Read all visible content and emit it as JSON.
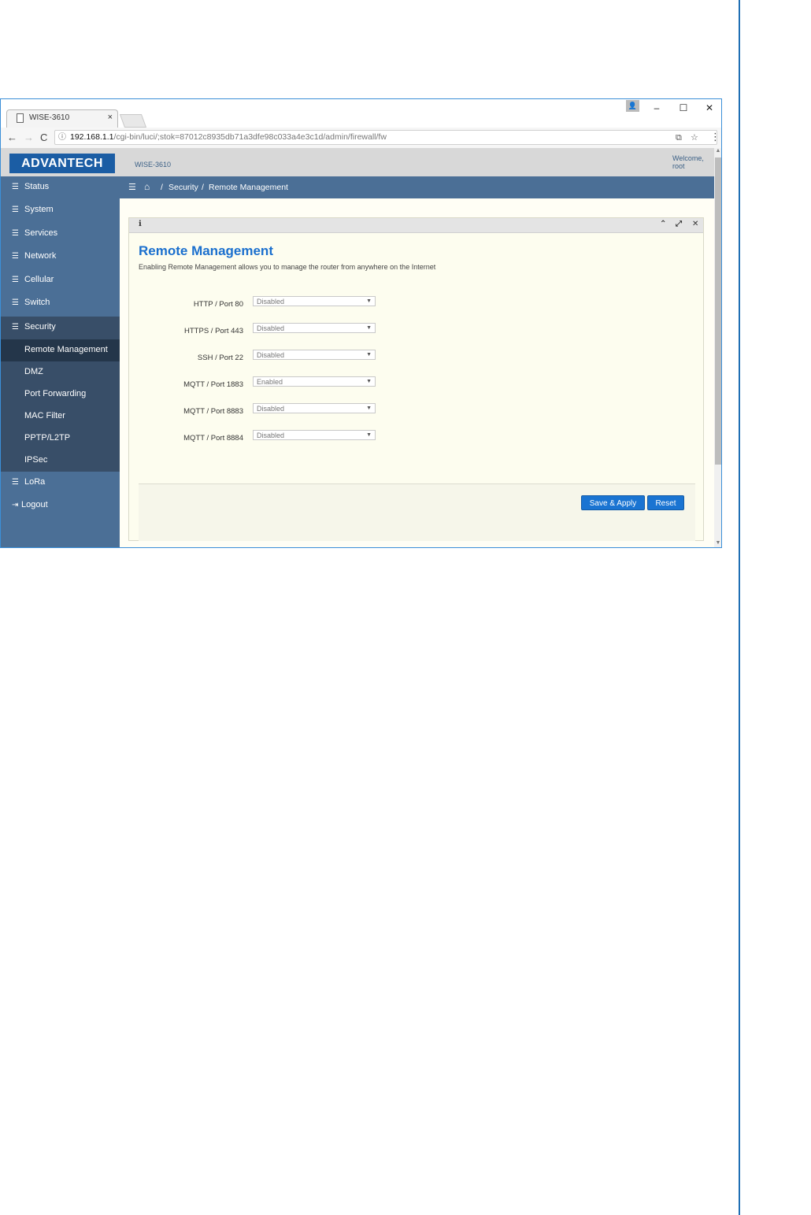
{
  "browser": {
    "tab_title": "WISE-3610",
    "tab_close": "×",
    "window_minimize": "–",
    "window_maximize": "☐",
    "window_close": "✕",
    "nav_back": "←",
    "nav_forward": "→",
    "nav_reload": "C",
    "url_host": "192.168.1.1",
    "url_path": "/cgi-bin/luci/;stok=87012c8935db71a3dfe98c033a4e3c1d/admin/firewall/fw"
  },
  "header": {
    "logo_text": "ADVANTECH",
    "model": "WISE-3610",
    "welcome_line1": "Welcome,",
    "welcome_line2": "root"
  },
  "sidebar": {
    "items": [
      {
        "label": "Status"
      },
      {
        "label": "System"
      },
      {
        "label": "Services"
      },
      {
        "label": "Network"
      },
      {
        "label": "Cellular"
      },
      {
        "label": "Switch"
      },
      {
        "label": "Security"
      }
    ],
    "security_sub": [
      {
        "label": "Remote Management"
      },
      {
        "label": "DMZ"
      },
      {
        "label": "Port Forwarding"
      },
      {
        "label": "MAC Filter"
      },
      {
        "label": "PPTP/L2TP"
      },
      {
        "label": "IPSec"
      }
    ],
    "lora_label": "LoRa",
    "logout_label": "Logout"
  },
  "breadcrumb": {
    "separator": "/",
    "section": "Security",
    "page": "Remote Management"
  },
  "panel": {
    "title": "Remote Management",
    "description": "Enabling Remote Management allows you to manage the router from anywhere on the Internet",
    "fields": [
      {
        "label": "HTTP / Port 80",
        "value": "Disabled"
      },
      {
        "label": "HTTPS / Port 443",
        "value": "Disabled"
      },
      {
        "label": "SSH / Port 22",
        "value": "Disabled"
      },
      {
        "label": "MQTT / Port 1883",
        "value": "Enabled"
      },
      {
        "label": "MQTT / Port 8883",
        "value": "Disabled"
      },
      {
        "label": "MQTT / Port 8884",
        "value": "Disabled"
      }
    ],
    "save_label": "Save & Apply",
    "reset_label": "Reset"
  },
  "colors": {
    "sidebar": "#4b6f96",
    "sidebar_active": "#24364a",
    "accent": "#1a74d2",
    "title_blue": "#1a6fce"
  }
}
